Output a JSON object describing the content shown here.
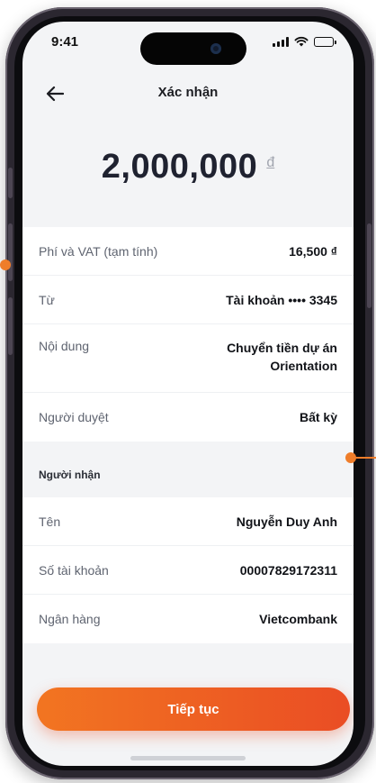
{
  "status_bar": {
    "time": "9:41"
  },
  "header": {
    "title": "Xác nhận"
  },
  "amount": {
    "value": "2,000,000",
    "currency": "đ"
  },
  "details": [
    {
      "label": "Phí và VAT (tạm tính)",
      "value": "16,500 ₫"
    },
    {
      "label": "Từ",
      "value": "Tài khoản •••• 3345"
    },
    {
      "label": "Nội dung",
      "value": "Chuyển tiền dự án Orientation"
    },
    {
      "label": "Người duyệt",
      "value": "Bất kỳ"
    }
  ],
  "recipient": {
    "section_title": "Người nhận",
    "rows": [
      {
        "label": "Tên",
        "value": "Nguyễn Duy Anh"
      },
      {
        "label": "Số tài khoản",
        "value": "00007829172311"
      },
      {
        "label": "Ngân hàng",
        "value": "Vietcombank"
      }
    ]
  },
  "actions": {
    "continue_label": "Tiếp tục"
  },
  "colors": {
    "accent_start": "#f27521",
    "accent_end": "#ea4d24",
    "background": "#f3f4f6"
  },
  "icons": {
    "back": "arrow-left-icon",
    "signal": "signal-icon",
    "wifi": "wifi-icon",
    "battery": "battery-icon"
  }
}
